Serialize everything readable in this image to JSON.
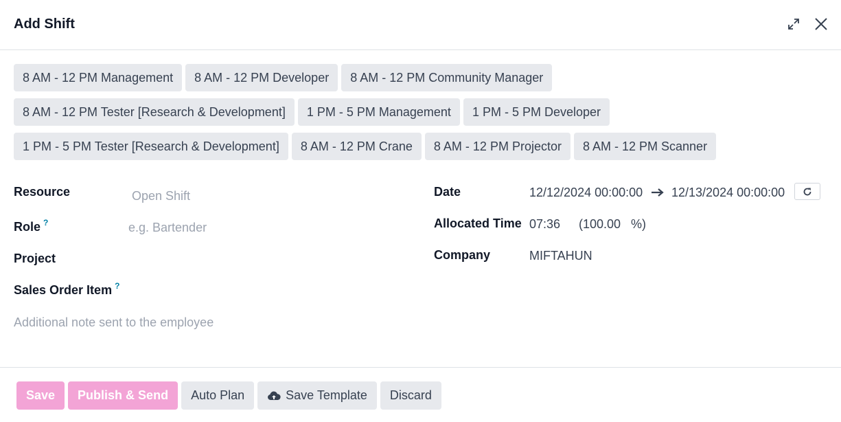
{
  "dialog": {
    "title": "Add Shift",
    "icons": {
      "expand": "expand-icon",
      "close": "close-icon"
    }
  },
  "templates": {
    "rows": [
      [
        "8 AM - 12 PM Management",
        "8 AM - 12 PM Developer",
        "8 AM - 12 PM Community Manager"
      ],
      [
        "8 AM - 12 PM Tester [Research & Development]",
        "1 PM - 5 PM Management",
        "1 PM - 5 PM Developer"
      ],
      [
        "1 PM - 5 PM Tester [Research & Development]",
        "8 AM - 12 PM Crane",
        "8 AM - 12 PM Projector",
        "8 AM - 12 PM Scanner"
      ]
    ]
  },
  "form": {
    "resource": {
      "label": "Resource",
      "placeholder": "Open Shift"
    },
    "role": {
      "label": "Role",
      "help": "?",
      "placeholder": "e.g. Bartender"
    },
    "project": {
      "label": "Project"
    },
    "sales_order_item": {
      "label": "Sales Order Item",
      "help": "?"
    },
    "note": {
      "placeholder": "Additional note sent to the employee"
    },
    "date": {
      "label": "Date",
      "start": "12/12/2024 00:00:00",
      "end": "12/13/2024 00:00:00",
      "arrow_icon": "long-arrow-right-icon",
      "refresh_icon": "refresh-icon"
    },
    "allocated_time": {
      "label": "Allocated Time",
      "hours": "07:36",
      "percent": "(100.00",
      "percent_sign": "%)"
    },
    "company": {
      "label": "Company",
      "value": "MIFTAHUN"
    }
  },
  "footer": {
    "save": "Save",
    "publish": "Publish & Send",
    "auto_plan": "Auto Plan",
    "save_template": "Save Template",
    "save_template_icon": "cloud-upload-icon",
    "discard": "Discard"
  },
  "colors": {
    "primary_disabled": "#f3a4d6",
    "secondary_bg": "#e7e9ed",
    "help": "#0180a5"
  }
}
